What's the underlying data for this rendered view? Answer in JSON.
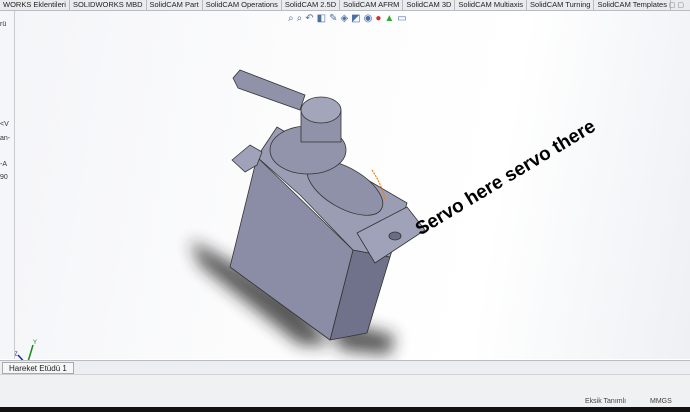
{
  "tabs": [
    "WORKS Eklentileri",
    "SOLIDWORKS MBD",
    "SolidCAM Part",
    "SolidCAM Operations",
    "SolidCAM 2.5D",
    "SolidCAM AFRM",
    "SolidCAM 3D",
    "SolidCAM Multiaxis",
    "SolidCAM Turning",
    "SolidCAM Templates"
  ],
  "toolbar_icons": [
    "zoom-to-fit-icon",
    "zoom-area-icon",
    "previous-view-icon",
    "section-view-icon",
    "dynamic-annotation-icon",
    "view-orientation-icon",
    "display-style-icon",
    "hide-show-icon",
    "edit-appearance-icon",
    "apply-scene-icon",
    "view-settings-icon"
  ],
  "left_panel": [
    "rü",
    "<V",
    "an-",
    "-A",
    "90"
  ],
  "viewport": {
    "caption": "Servo here servo there",
    "triad": {
      "x": "X",
      "y": "Y",
      "z": "Z"
    },
    "model_color": "#8f92a8"
  },
  "bottom_tab": "Hareket Etüdü 1",
  "status": {
    "definition": "Eksik Tanımlı",
    "units": "MMGS"
  }
}
